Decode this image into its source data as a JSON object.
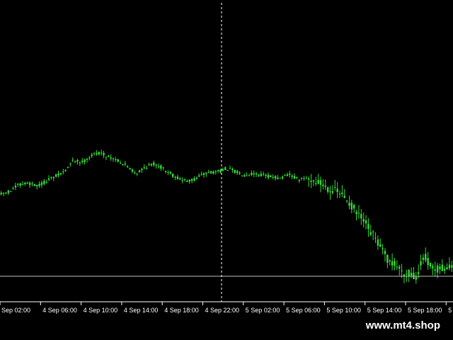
{
  "chart_data": {
    "type": "candlestick",
    "title": "",
    "xlabel": "",
    "ylabel": "",
    "grid": false,
    "x_tick_labels": [
      "Sep 02:00",
      "4 Sep 06:00",
      "4 Sep 10:00",
      "4 Sep 14:00",
      "4 Sep 18:00",
      "4 Sep 22:00",
      "5 Sep 02:00",
      "5 Sep 06:00",
      "5 Sep 10:00",
      "5 Sep 14:00",
      "5 Sep 18:00",
      "5 S"
    ],
    "price_path": [
      [
        0,
        63
      ],
      [
        1,
        65
      ],
      [
        2,
        69
      ],
      [
        3,
        70
      ],
      [
        4,
        68
      ],
      [
        5,
        71
      ],
      [
        6,
        74
      ],
      [
        7,
        77
      ],
      [
        8,
        84
      ],
      [
        9,
        83
      ],
      [
        10,
        87
      ],
      [
        11,
        89
      ],
      [
        12,
        86
      ],
      [
        13,
        84
      ],
      [
        14,
        80
      ],
      [
        15,
        76
      ],
      [
        16,
        80
      ],
      [
        17,
        82
      ],
      [
        18,
        79
      ],
      [
        19,
        75
      ],
      [
        20,
        72
      ],
      [
        21,
        71
      ],
      [
        22,
        74
      ],
      [
        23,
        77
      ],
      [
        24,
        77
      ],
      [
        25,
        79
      ],
      [
        26,
        77
      ],
      [
        27,
        75
      ],
      [
        28,
        76
      ],
      [
        29,
        75
      ],
      [
        30,
        74
      ],
      [
        31,
        73
      ],
      [
        32,
        75
      ],
      [
        33,
        72
      ],
      [
        34,
        73
      ],
      [
        35,
        71
      ],
      [
        36,
        68
      ],
      [
        37,
        65
      ],
      [
        38,
        62
      ],
      [
        39,
        55
      ],
      [
        40,
        48
      ],
      [
        41,
        40
      ],
      [
        42,
        31
      ],
      [
        43,
        22
      ],
      [
        44,
        18
      ],
      [
        45,
        14
      ],
      [
        46,
        12
      ],
      [
        47,
        25
      ],
      [
        48,
        15
      ],
      [
        49,
        18
      ],
      [
        50,
        17
      ]
    ],
    "colors": {
      "background": "#000000",
      "candle": "#33dd33",
      "crosshair": "#ffffff",
      "price_line": "#c0c0c0",
      "axis_text": "#ffffff"
    }
  },
  "watermark": "www.mt4.shop"
}
